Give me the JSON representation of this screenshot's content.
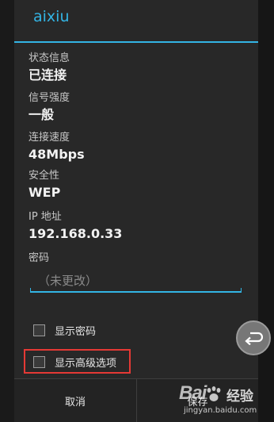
{
  "dialog": {
    "title": "aixiu",
    "fields": [
      {
        "label": "状态信息",
        "value": "已连接"
      },
      {
        "label": "信号强度",
        "value": "一般"
      },
      {
        "label": "连接速度",
        "value": "48Mbps"
      },
      {
        "label": "安全性",
        "value": "WEP"
      },
      {
        "label": "IP 地址",
        "value": "192.168.0.33"
      }
    ],
    "password": {
      "label": "密码",
      "placeholder": "（未更改）"
    },
    "show_password_label": "显示密码",
    "show_advanced_label": "显示高级选项",
    "cancel_label": "取消",
    "save_label": "保存"
  },
  "watermark": {
    "logo": "Bai",
    "title": "经验",
    "subtitle": "jingyan.baidu.com"
  },
  "colors": {
    "accent": "#33b5e5",
    "dialog_bg": "#282828",
    "highlight": "#e53935"
  }
}
